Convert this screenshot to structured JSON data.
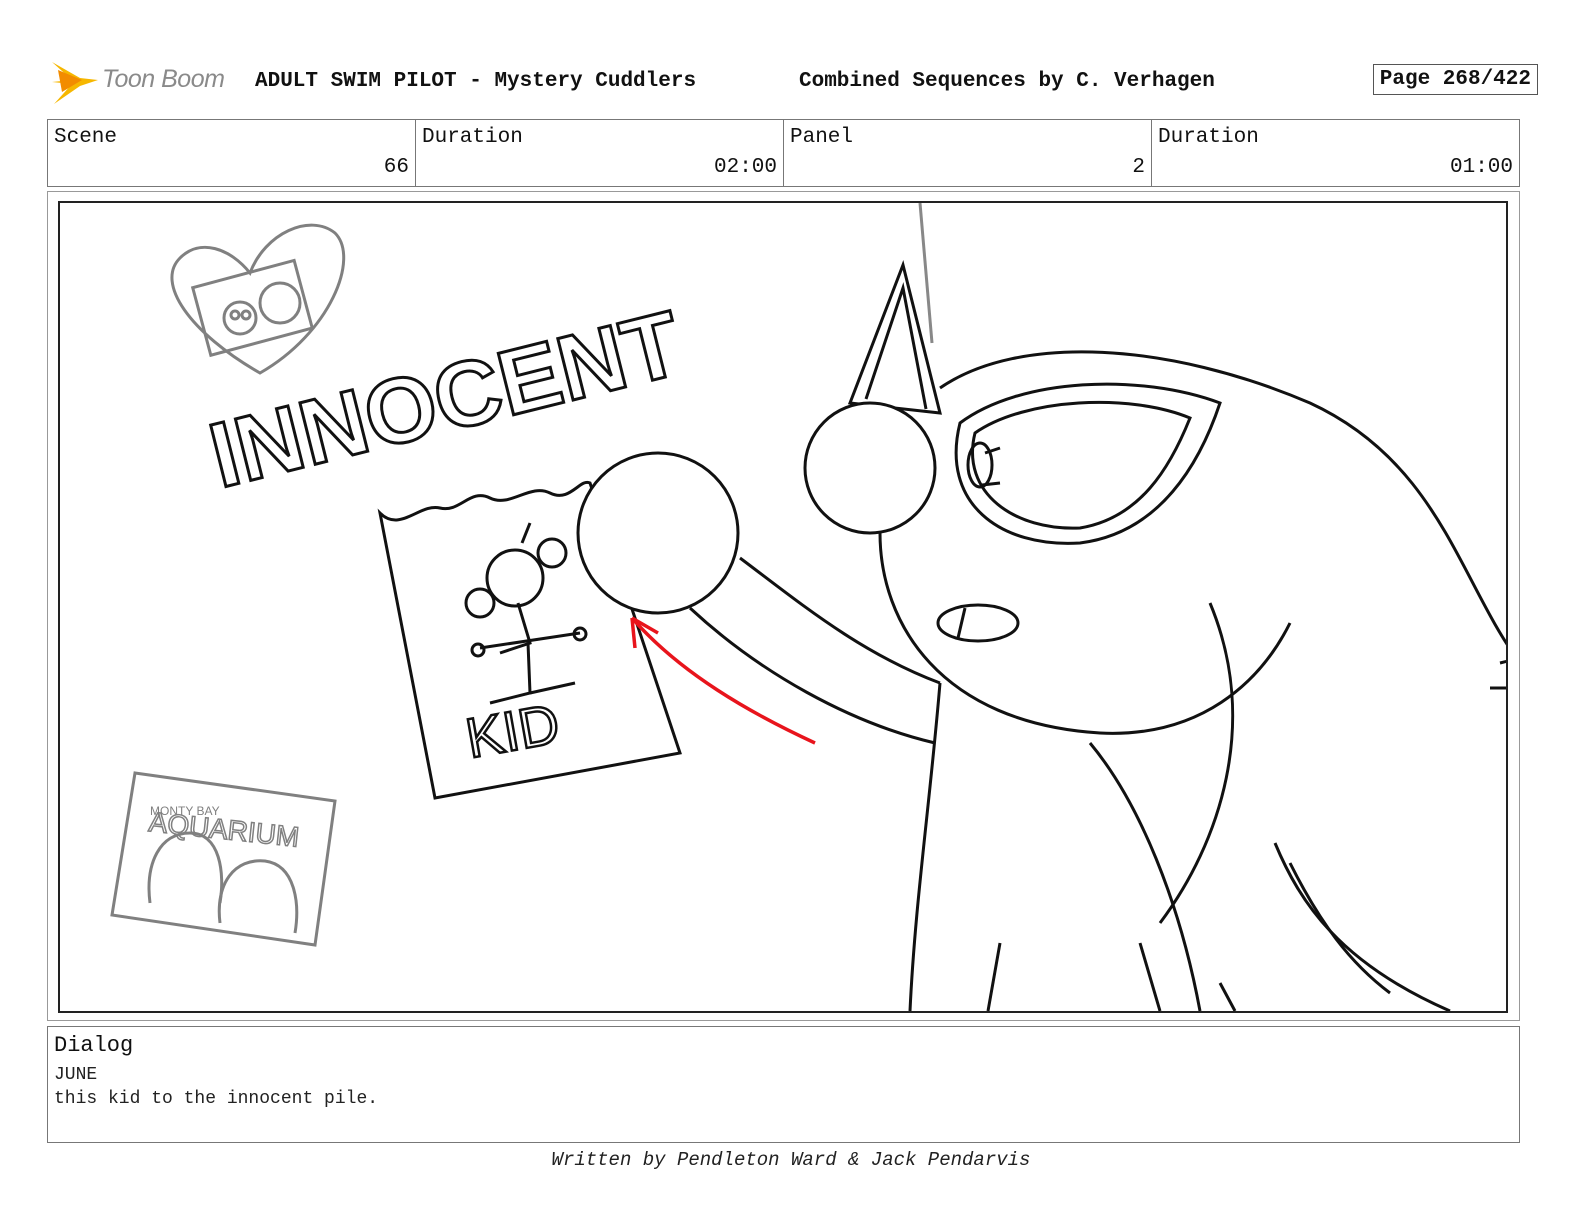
{
  "header": {
    "logo_text": "Toon Boom",
    "title": "ADULT SWIM PILOT - Mystery Cuddlers",
    "credit": "Combined Sequences by C. Verhagen",
    "page": "Page 268/422"
  },
  "info": {
    "scene_label": "Scene",
    "scene_value": "66",
    "scene_duration_label": "Duration",
    "scene_duration_value": "02:00",
    "panel_label": "Panel",
    "panel_value": "2",
    "panel_duration_label": "Duration",
    "panel_duration_value": "01:00"
  },
  "panel": {
    "sign_word": "INNOCENT",
    "note_word": "KID",
    "sticker_text": "AQUARIUM",
    "sticker_subtext": "MONTY BAY",
    "arrow_color": "#e8141c"
  },
  "dialog": {
    "label": "Dialog",
    "speaker": "JUNE",
    "line": "this kid to the innocent pile."
  },
  "footer": {
    "text": "Written by Pendleton Ward & Jack Pendarvis"
  }
}
